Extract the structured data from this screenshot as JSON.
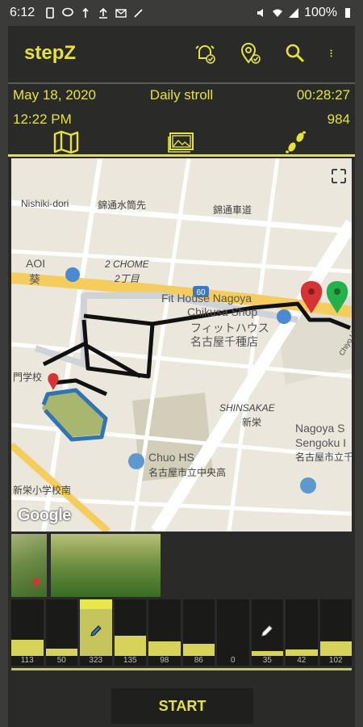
{
  "status_bar": {
    "time": "6:12",
    "battery": "100%"
  },
  "app": {
    "title": "stepZ"
  },
  "walk": {
    "date": "May 18, 2020",
    "name": "Daily stroll",
    "duration": "00:28:27",
    "start_time": "12:22 PM",
    "steps": "984"
  },
  "tabs": [
    {
      "icon": "map-icon"
    },
    {
      "icon": "photo-gallery-icon"
    },
    {
      "icon": "footsteps-icon"
    }
  ],
  "map": {
    "labels": {
      "nishiki": "Nishiki-dori",
      "kanji_top_left": "錦通水筒先",
      "kanji_top_right": "錦通車道",
      "aoi_en": "AOI",
      "aoi_jp": "葵",
      "chome_en": "2 CHOME",
      "chome_jp": "2丁目",
      "fit_en": "Fit House Nagoya",
      "fit_en2": "Chikusa Shop",
      "fit_jp": "フィットハウス",
      "fit_jp2": "名古屋千種店",
      "shinsakae_en": "SHINSAKAE",
      "shinsakae_jp": "新栄",
      "school_jp": "門学校",
      "chuo_en": "Chuo HS",
      "chuo_jp": "名古屋市立中央高",
      "nagoya_s": "Nagoya S",
      "sengoku": "Sengoku I",
      "nagoya_jp": "名古屋市立千",
      "shinei_jp": "新栄小学校南",
      "route_num": "60",
      "chiyo": "Chiyo Line"
    },
    "google": "Google"
  },
  "photo_count": 2,
  "bars": [
    {
      "value": "113",
      "level": 0.29
    },
    {
      "value": "50",
      "level": 0.13
    },
    {
      "value": "323",
      "level": 0.83,
      "selected": true,
      "icon": "pencil-icon"
    },
    {
      "value": "135",
      "level": 0.35
    },
    {
      "value": "98",
      "level": 0.25
    },
    {
      "value": "86",
      "level": 0.22
    },
    {
      "value": "0",
      "level": 0
    },
    {
      "value": "35",
      "level": 0.09,
      "icon": "pencil-icon"
    },
    {
      "value": "42",
      "level": 0.11
    },
    {
      "value": "102",
      "level": 0.26
    }
  ],
  "start_label": "START",
  "colors": {
    "accent": "#e5e33b",
    "background": "#2a2a28",
    "bar": "#d7d35a"
  }
}
